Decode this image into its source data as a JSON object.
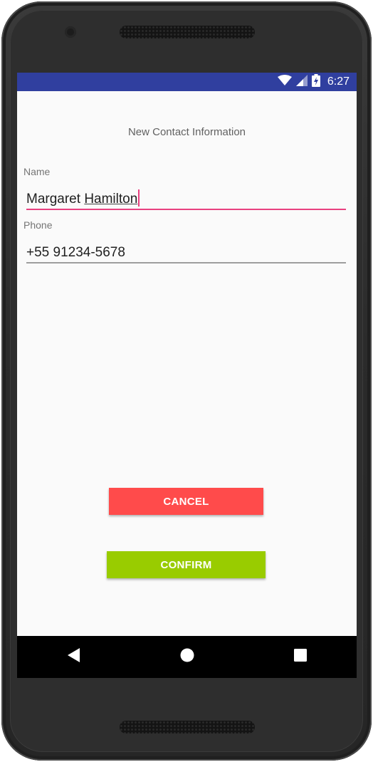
{
  "status_bar": {
    "time": "6:27",
    "background_color": "#303f9f",
    "icons": [
      "wifi-icon",
      "signal-icon",
      "battery-charging-icon"
    ]
  },
  "form": {
    "heading": "New Contact Information",
    "name": {
      "label": "Name",
      "value_first": "Margaret ",
      "value_last": "Hamilton"
    },
    "phone": {
      "label": "Phone",
      "value": "+55 91234-5678"
    }
  },
  "buttons": {
    "cancel_label": "CANCEL",
    "cancel_color": "#ff4b4b",
    "confirm_label": "CONFIRM",
    "confirm_color": "#99cc00"
  },
  "nav_bar": {
    "icons": [
      "back-icon",
      "home-icon",
      "recents-icon"
    ]
  }
}
